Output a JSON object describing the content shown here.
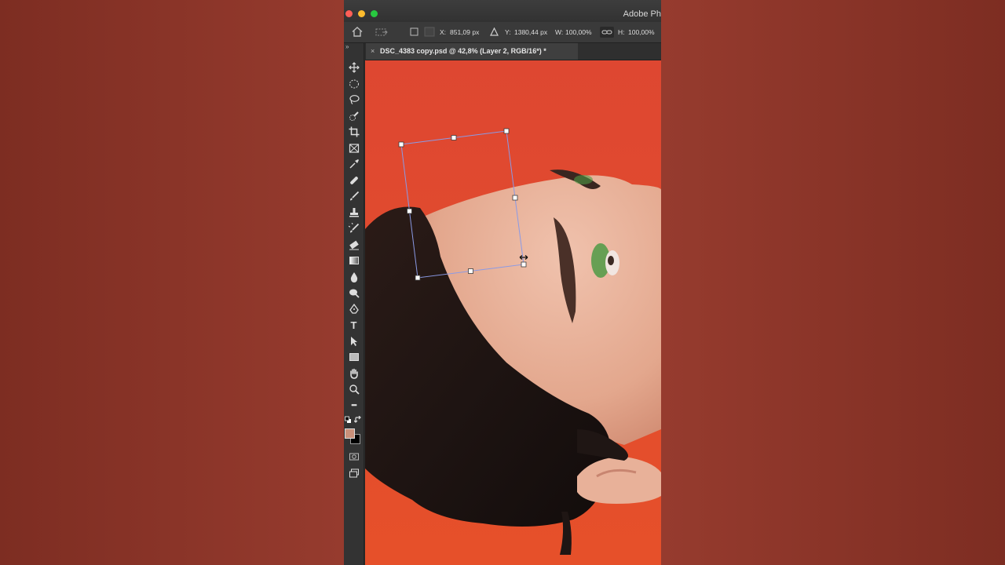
{
  "app": {
    "title": "Adobe Ph",
    "traffic_lights": [
      "close",
      "minimize",
      "zoom"
    ]
  },
  "options_bar": {
    "x_label": "X:",
    "x_value": "851,09 px",
    "y_label": "Y:",
    "y_value": "1380,44 px",
    "w_label": "W:",
    "w_value": "100,00%",
    "h_label": "H:",
    "h_value": "100,00%"
  },
  "document_tab": {
    "close": "×",
    "title": "DSC_4383 copy.psd @ 42,8% (Layer 2, RGB/16*) *"
  },
  "toolbar": {
    "grip": "»",
    "type_tool": "T",
    "more": "•••",
    "tools": [
      "move-icon",
      "elliptical-marquee-icon",
      "lasso-icon",
      "quick-selection-icon",
      "crop-icon",
      "frame-icon",
      "eyedropper-icon",
      "healing-brush-icon",
      "brush-icon",
      "clone-stamp-icon",
      "history-brush-icon",
      "eraser-icon",
      "gradient-icon",
      "blur-icon",
      "dodge-icon",
      "pen-icon",
      "type-icon",
      "path-selection-icon",
      "rectangle-icon",
      "hand-icon",
      "zoom-icon"
    ],
    "foreground_color": "#c9907a",
    "background_color": "#000000"
  },
  "canvas": {
    "background_color": "#dc4530",
    "skin_color": "#e8b199",
    "hair_color": "#1f1614",
    "eyeshadow_color": "#4f9a45",
    "transform_box_color": "#8a9ae6"
  }
}
